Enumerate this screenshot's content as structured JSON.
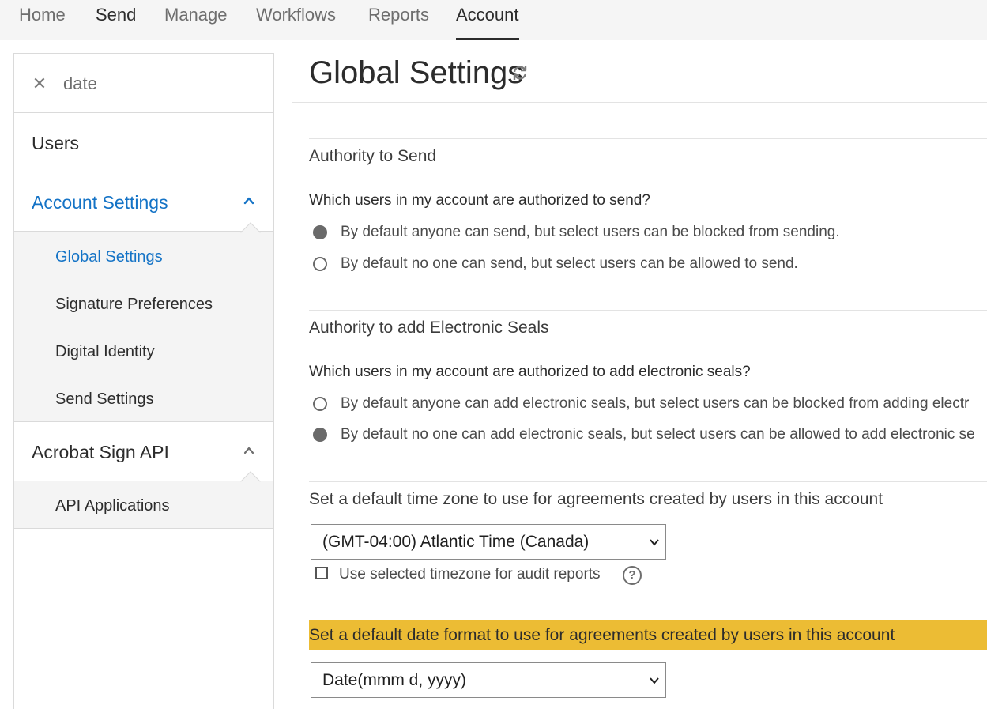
{
  "nav": {
    "tabs": [
      "Home",
      "Send",
      "Manage",
      "Workflows",
      "Reports",
      "Account"
    ],
    "active": "Account"
  },
  "sidebar": {
    "search_value": "date",
    "items": {
      "users": "Users",
      "account_settings": "Account Settings",
      "acrobat_sign_api": "Acrobat Sign API"
    },
    "account_settings_children": [
      "Global Settings",
      "Signature Preferences",
      "Digital Identity",
      "Send Settings"
    ],
    "api_children": [
      "API Applications"
    ],
    "selected": "Global Settings"
  },
  "main": {
    "title": "Global Settings",
    "authority_send": {
      "heading": "Authority to Send",
      "question": "Which users in my account are authorized to send?",
      "options": [
        "By default anyone can send, but select users can be blocked from sending.",
        "By default no one can send, but select users can be allowed to send."
      ],
      "selected_index": 0
    },
    "authority_seals": {
      "heading": "Authority to add Electronic Seals",
      "question": "Which users in my account are authorized to add electronic seals?",
      "options": [
        "By default anyone can add electronic seals, but select users can be blocked from adding electr",
        "By default no one can add electronic seals, but select users can be allowed to add electronic se"
      ],
      "selected_index": 1
    },
    "timezone": {
      "heading": "Set a default time zone to use for agreements created by users in this account",
      "value": "(GMT-04:00) Atlantic Time (Canada)",
      "checkbox_label": "Use selected timezone for audit reports",
      "checkbox_checked": false
    },
    "date_format": {
      "heading": "Set a default date format to use for agreements created by users in this account",
      "value": "Date(mmm d, yyyy)"
    }
  },
  "colors": {
    "link_blue": "#1473c6",
    "highlight": "#ecbc34"
  }
}
